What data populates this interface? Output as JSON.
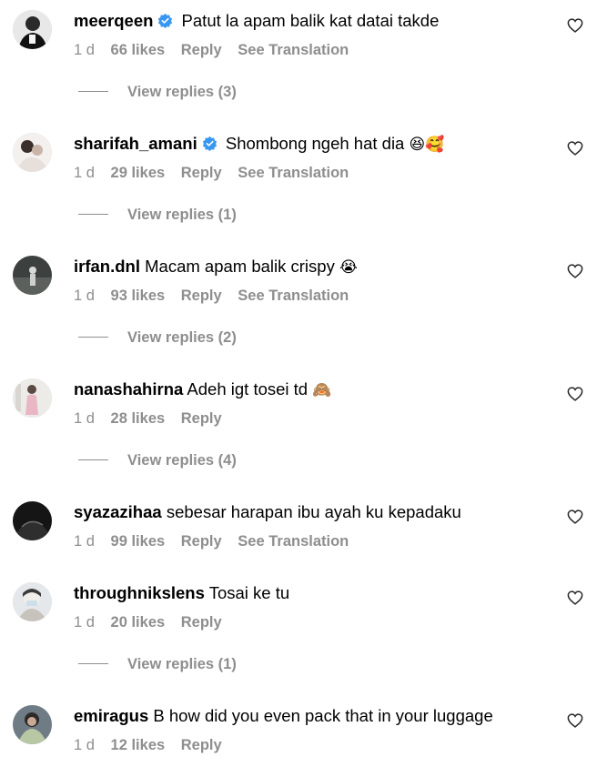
{
  "comments": [
    {
      "username": "meerqeen",
      "verified": true,
      "text": "Patut la apam balik kat datai takde",
      "emoji": "",
      "time": "1 d",
      "likes": "66 likes",
      "reply": "Reply",
      "translate": "See Translation",
      "replies": "View replies (3)"
    },
    {
      "username": "sharifah_amani",
      "verified": true,
      "text": "Shombong ngeh hat dia",
      "emoji": "😆🥰",
      "time": "1 d",
      "likes": "29 likes",
      "reply": "Reply",
      "translate": "See Translation",
      "replies": "View replies (1)"
    },
    {
      "username": "irfan.dnl",
      "verified": false,
      "text": "Macam apam balik crispy",
      "emoji": "😭",
      "time": "1 d",
      "likes": "93 likes",
      "reply": "Reply",
      "translate": "See Translation",
      "replies": "View replies (2)"
    },
    {
      "username": "nanashahirna",
      "verified": false,
      "text": "Adeh igt tosei td",
      "emoji": "🙈",
      "time": "1 d",
      "likes": "28 likes",
      "reply": "Reply",
      "translate": "",
      "replies": "View replies (4)"
    },
    {
      "username": "syazazihaa",
      "verified": false,
      "text": "sebesar harapan ibu ayah ku kepadaku",
      "emoji": "",
      "time": "1 d",
      "likes": "99 likes",
      "reply": "Reply",
      "translate": "See Translation",
      "replies": ""
    },
    {
      "username": "throughnikslens",
      "verified": false,
      "text": "Tosai ke tu",
      "emoji": "",
      "time": "1 d",
      "likes": "20 likes",
      "reply": "Reply",
      "translate": "",
      "replies": "View replies (1)"
    },
    {
      "username": "emiragus",
      "verified": false,
      "text": "B how did you even pack that in your luggage",
      "emoji": "",
      "time": "1 d",
      "likes": "12 likes",
      "reply": "Reply",
      "translate": "",
      "replies": ""
    }
  ],
  "colors": {
    "text": "#000000",
    "meta": "#8e8e8e",
    "verified": "#3897f0"
  },
  "icons": {
    "like": "heart-icon",
    "verified": "verified-badge-icon"
  }
}
